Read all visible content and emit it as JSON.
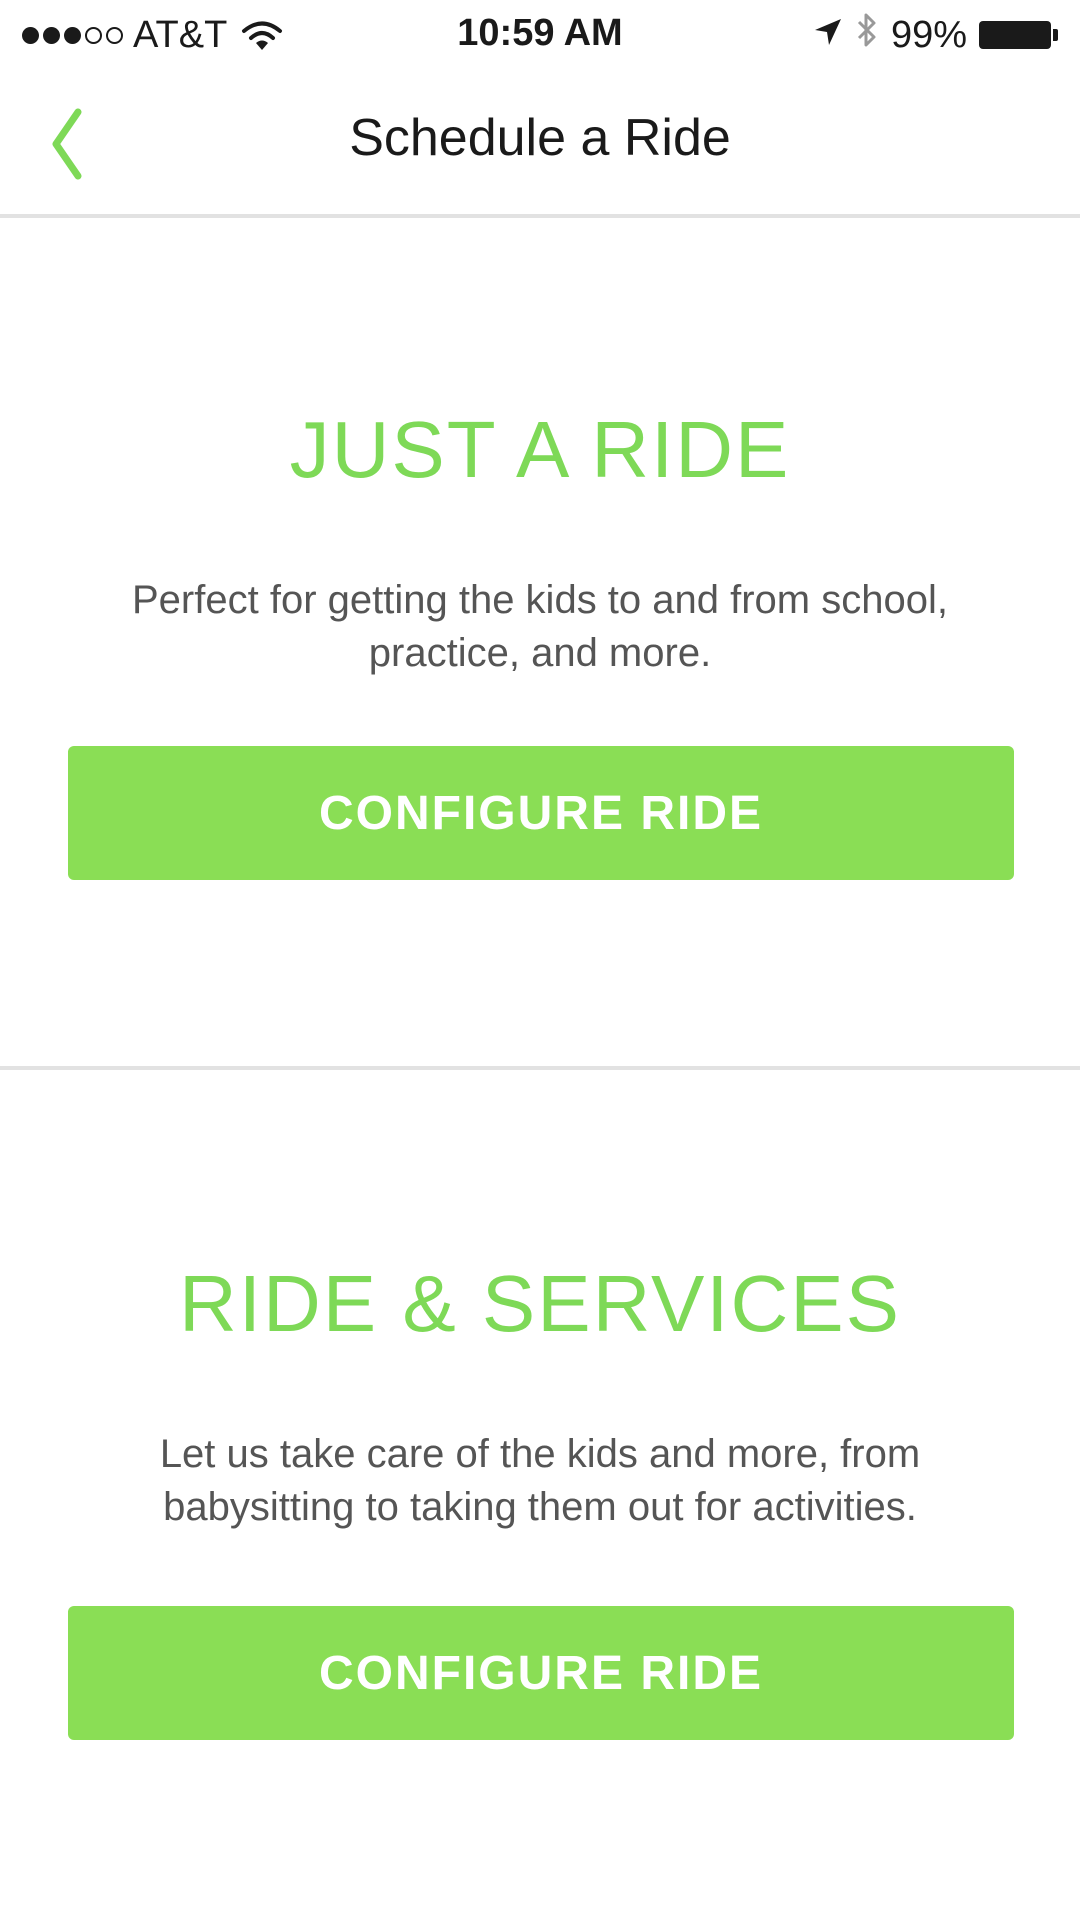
{
  "status_bar": {
    "carrier": "AT&T",
    "time": "10:59 AM",
    "battery": "99%",
    "signal_bars_filled": 3,
    "signal_bars_total": 5
  },
  "nav": {
    "title": "Schedule a Ride",
    "back_icon": "chevron-left-icon",
    "accent_color": "#7ed957"
  },
  "sections": [
    {
      "title": "JUST A RIDE",
      "description": "Perfect for getting the kids to and from school, practice, and more.",
      "button_label": "CONFIGURE RIDE"
    },
    {
      "title": "RIDE & SERVICES",
      "description": "Let us take care of the kids and more, from babysitting to taking them out for activities.",
      "button_label": "CONFIGURE RIDE"
    }
  ],
  "colors": {
    "accent": "#7ed957",
    "button_bg": "#8ade55",
    "button_text": "#ffffff"
  }
}
